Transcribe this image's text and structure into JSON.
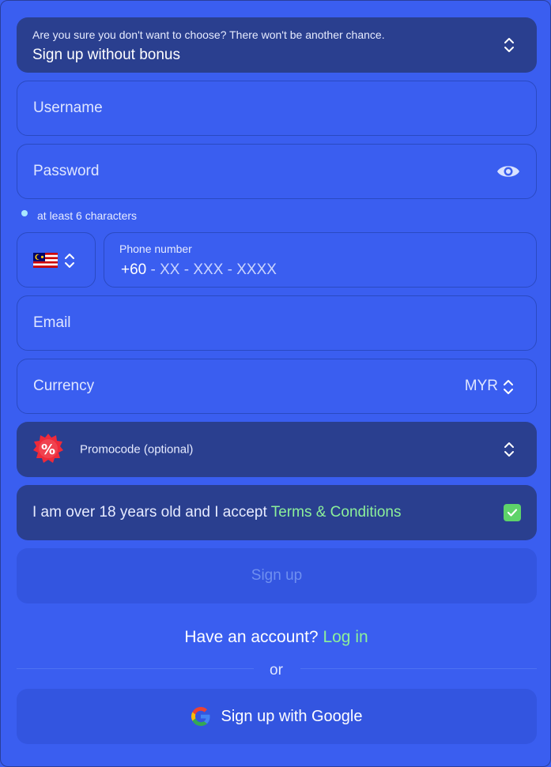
{
  "bonus": {
    "subtitle": "Are you sure you don't want to choose? There won't be another chance.",
    "selected": "Sign up without bonus"
  },
  "username": {
    "placeholder": "Username"
  },
  "password": {
    "placeholder": "Password",
    "hint": "at least 6 characters"
  },
  "phone": {
    "country_flag": "malaysia-flag-icon",
    "label": "Phone number",
    "code": "+60",
    "mask": " - XX - XXX - XXXX"
  },
  "email": {
    "placeholder": "Email"
  },
  "currency": {
    "label": "Currency",
    "value": "MYR"
  },
  "promo": {
    "label": "Promocode (optional)"
  },
  "terms": {
    "text": "I am over 18 years old and I accept ",
    "link": "Terms & Conditions",
    "checked": true
  },
  "signup": {
    "label": "Sign up"
  },
  "account": {
    "question": "Have an account? ",
    "login": "Log in"
  },
  "divider": {
    "text": "or"
  },
  "google": {
    "label": "Sign up with Google"
  },
  "colors": {
    "background": "#3a5ef0",
    "panel_dark": "#2a3f8f",
    "accent_green": "#8cf09a",
    "button": "#3355e0"
  }
}
